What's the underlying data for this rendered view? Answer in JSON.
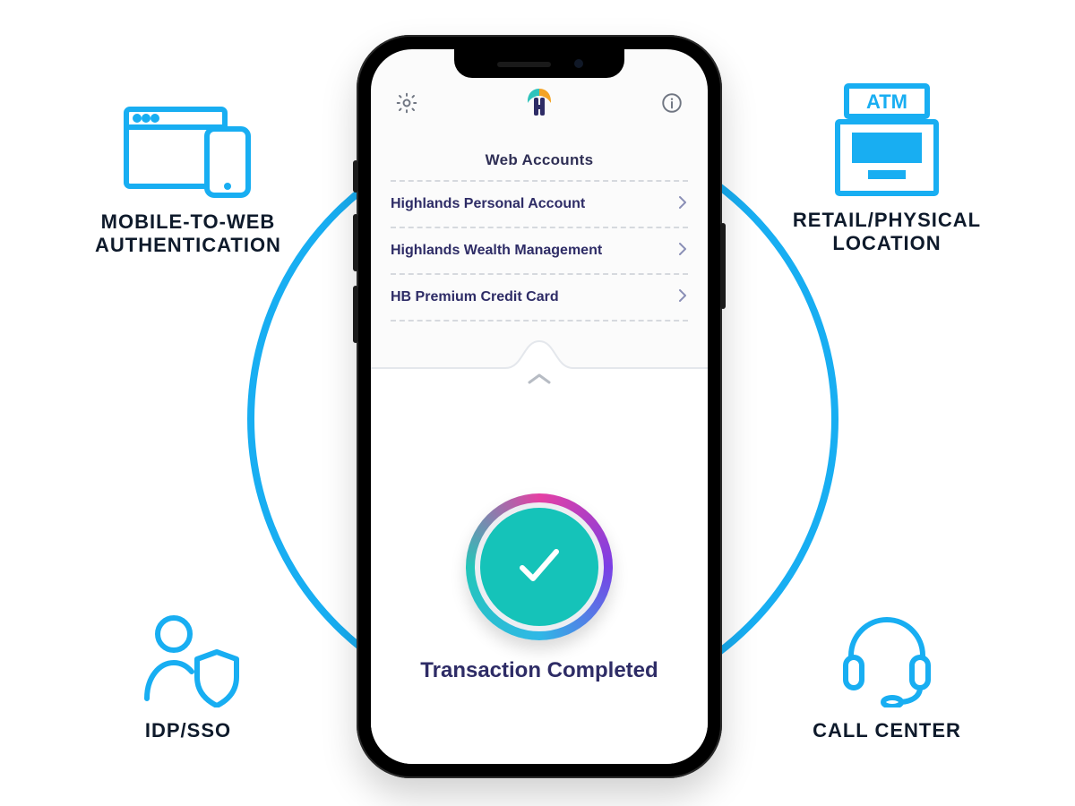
{
  "outer": {
    "tl": "MOBILE-TO-WEB\nAUTHENTICATION",
    "tr": "RETAIL/PHYSICAL\nLOCATION",
    "bl": "IDP/SSO",
    "br": "CALL CENTER",
    "atm_label": "ATM"
  },
  "app": {
    "section_title": "Web Accounts",
    "accounts": [
      "Highlands Personal Account",
      "Highlands Wealth Management",
      "HB Premium Credit Card"
    ],
    "transaction_label": "Transaction Completed"
  },
  "icons": {
    "settings": "gear-icon",
    "info": "info-icon",
    "chevron": "chevron-right-icon",
    "up": "chevron-up-icon",
    "check": "check-icon"
  },
  "colors": {
    "accent": "#18aef2",
    "check_bg": "#15c3b9",
    "text_primary": "#2e2c66"
  }
}
